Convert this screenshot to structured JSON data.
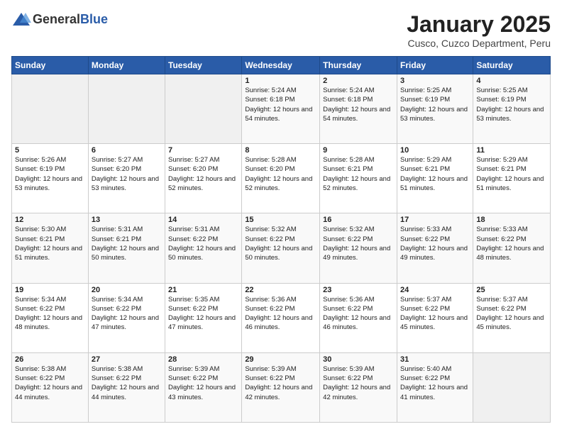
{
  "logo": {
    "general": "General",
    "blue": "Blue"
  },
  "title": "January 2025",
  "subtitle": "Cusco, Cuzco Department, Peru",
  "weekdays": [
    "Sunday",
    "Monday",
    "Tuesday",
    "Wednesday",
    "Thursday",
    "Friday",
    "Saturday"
  ],
  "weeks": [
    [
      {
        "day": "",
        "sunrise": "",
        "sunset": "",
        "daylight": ""
      },
      {
        "day": "",
        "sunrise": "",
        "sunset": "",
        "daylight": ""
      },
      {
        "day": "",
        "sunrise": "",
        "sunset": "",
        "daylight": ""
      },
      {
        "day": "1",
        "sunrise": "Sunrise: 5:24 AM",
        "sunset": "Sunset: 6:18 PM",
        "daylight": "Daylight: 12 hours and 54 minutes."
      },
      {
        "day": "2",
        "sunrise": "Sunrise: 5:24 AM",
        "sunset": "Sunset: 6:18 PM",
        "daylight": "Daylight: 12 hours and 54 minutes."
      },
      {
        "day": "3",
        "sunrise": "Sunrise: 5:25 AM",
        "sunset": "Sunset: 6:19 PM",
        "daylight": "Daylight: 12 hours and 53 minutes."
      },
      {
        "day": "4",
        "sunrise": "Sunrise: 5:25 AM",
        "sunset": "Sunset: 6:19 PM",
        "daylight": "Daylight: 12 hours and 53 minutes."
      }
    ],
    [
      {
        "day": "5",
        "sunrise": "Sunrise: 5:26 AM",
        "sunset": "Sunset: 6:19 PM",
        "daylight": "Daylight: 12 hours and 53 minutes."
      },
      {
        "day": "6",
        "sunrise": "Sunrise: 5:27 AM",
        "sunset": "Sunset: 6:20 PM",
        "daylight": "Daylight: 12 hours and 53 minutes."
      },
      {
        "day": "7",
        "sunrise": "Sunrise: 5:27 AM",
        "sunset": "Sunset: 6:20 PM",
        "daylight": "Daylight: 12 hours and 52 minutes."
      },
      {
        "day": "8",
        "sunrise": "Sunrise: 5:28 AM",
        "sunset": "Sunset: 6:20 PM",
        "daylight": "Daylight: 12 hours and 52 minutes."
      },
      {
        "day": "9",
        "sunrise": "Sunrise: 5:28 AM",
        "sunset": "Sunset: 6:21 PM",
        "daylight": "Daylight: 12 hours and 52 minutes."
      },
      {
        "day": "10",
        "sunrise": "Sunrise: 5:29 AM",
        "sunset": "Sunset: 6:21 PM",
        "daylight": "Daylight: 12 hours and 51 minutes."
      },
      {
        "day": "11",
        "sunrise": "Sunrise: 5:29 AM",
        "sunset": "Sunset: 6:21 PM",
        "daylight": "Daylight: 12 hours and 51 minutes."
      }
    ],
    [
      {
        "day": "12",
        "sunrise": "Sunrise: 5:30 AM",
        "sunset": "Sunset: 6:21 PM",
        "daylight": "Daylight: 12 hours and 51 minutes."
      },
      {
        "day": "13",
        "sunrise": "Sunrise: 5:31 AM",
        "sunset": "Sunset: 6:21 PM",
        "daylight": "Daylight: 12 hours and 50 minutes."
      },
      {
        "day": "14",
        "sunrise": "Sunrise: 5:31 AM",
        "sunset": "Sunset: 6:22 PM",
        "daylight": "Daylight: 12 hours and 50 minutes."
      },
      {
        "day": "15",
        "sunrise": "Sunrise: 5:32 AM",
        "sunset": "Sunset: 6:22 PM",
        "daylight": "Daylight: 12 hours and 50 minutes."
      },
      {
        "day": "16",
        "sunrise": "Sunrise: 5:32 AM",
        "sunset": "Sunset: 6:22 PM",
        "daylight": "Daylight: 12 hours and 49 minutes."
      },
      {
        "day": "17",
        "sunrise": "Sunrise: 5:33 AM",
        "sunset": "Sunset: 6:22 PM",
        "daylight": "Daylight: 12 hours and 49 minutes."
      },
      {
        "day": "18",
        "sunrise": "Sunrise: 5:33 AM",
        "sunset": "Sunset: 6:22 PM",
        "daylight": "Daylight: 12 hours and 48 minutes."
      }
    ],
    [
      {
        "day": "19",
        "sunrise": "Sunrise: 5:34 AM",
        "sunset": "Sunset: 6:22 PM",
        "daylight": "Daylight: 12 hours and 48 minutes."
      },
      {
        "day": "20",
        "sunrise": "Sunrise: 5:34 AM",
        "sunset": "Sunset: 6:22 PM",
        "daylight": "Daylight: 12 hours and 47 minutes."
      },
      {
        "day": "21",
        "sunrise": "Sunrise: 5:35 AM",
        "sunset": "Sunset: 6:22 PM",
        "daylight": "Daylight: 12 hours and 47 minutes."
      },
      {
        "day": "22",
        "sunrise": "Sunrise: 5:36 AM",
        "sunset": "Sunset: 6:22 PM",
        "daylight": "Daylight: 12 hours and 46 minutes."
      },
      {
        "day": "23",
        "sunrise": "Sunrise: 5:36 AM",
        "sunset": "Sunset: 6:22 PM",
        "daylight": "Daylight: 12 hours and 46 minutes."
      },
      {
        "day": "24",
        "sunrise": "Sunrise: 5:37 AM",
        "sunset": "Sunset: 6:22 PM",
        "daylight": "Daylight: 12 hours and 45 minutes."
      },
      {
        "day": "25",
        "sunrise": "Sunrise: 5:37 AM",
        "sunset": "Sunset: 6:22 PM",
        "daylight": "Daylight: 12 hours and 45 minutes."
      }
    ],
    [
      {
        "day": "26",
        "sunrise": "Sunrise: 5:38 AM",
        "sunset": "Sunset: 6:22 PM",
        "daylight": "Daylight: 12 hours and 44 minutes."
      },
      {
        "day": "27",
        "sunrise": "Sunrise: 5:38 AM",
        "sunset": "Sunset: 6:22 PM",
        "daylight": "Daylight: 12 hours and 44 minutes."
      },
      {
        "day": "28",
        "sunrise": "Sunrise: 5:39 AM",
        "sunset": "Sunset: 6:22 PM",
        "daylight": "Daylight: 12 hours and 43 minutes."
      },
      {
        "day": "29",
        "sunrise": "Sunrise: 5:39 AM",
        "sunset": "Sunset: 6:22 PM",
        "daylight": "Daylight: 12 hours and 42 minutes."
      },
      {
        "day": "30",
        "sunrise": "Sunrise: 5:39 AM",
        "sunset": "Sunset: 6:22 PM",
        "daylight": "Daylight: 12 hours and 42 minutes."
      },
      {
        "day": "31",
        "sunrise": "Sunrise: 5:40 AM",
        "sunset": "Sunset: 6:22 PM",
        "daylight": "Daylight: 12 hours and 41 minutes."
      },
      {
        "day": "",
        "sunrise": "",
        "sunset": "",
        "daylight": ""
      }
    ]
  ]
}
